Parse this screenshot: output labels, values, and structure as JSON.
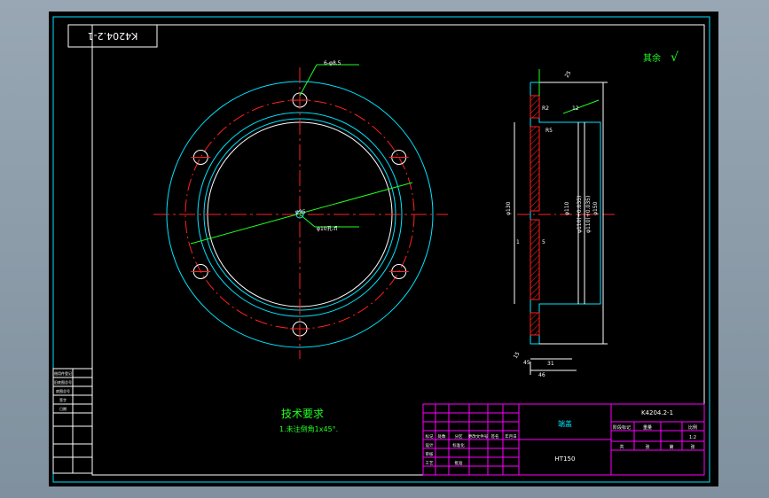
{
  "drawing": {
    "number_rotated": "K4204.2-1",
    "surface_note": "其余",
    "surface_note_symbol": "√",
    "tech_title": "技术要求",
    "tech_note": "1.未注倒角1x45°.",
    "annotations": {
      "hole_note": "6-φ8.5",
      "center_dia": "φ95",
      "center_note": "φ10孔-fl",
      "dim_top": "25",
      "dim_12": "12",
      "dim_r2": "R2",
      "dim_r5": "R5",
      "dim_5": "5",
      "dim_1": "1",
      "dim_15": "15",
      "dim_bottom1": "31",
      "dim_bottom2": "46",
      "dim_bottom3": "45",
      "dim_left": "φ130",
      "dim_mid": "φ110",
      "dim_vert1": "φ110(+0.035)",
      "dim_vert2": "φ110(+0.035)",
      "dim_right": "φ150"
    },
    "title_block": {
      "part_name": "端盖",
      "material": "HT150",
      "drawing_no": "K4204.2-1",
      "stage_label": "阶段标记",
      "weight_label": "重量",
      "scale_label": "比例",
      "scale_value": "1:2",
      "sheet_total": "共",
      "sheet_no": "第",
      "sheet_word": "张",
      "sheet_word2": "张",
      "rows": [
        [
          "标记",
          "处数",
          "分区",
          "更改文件号",
          "签名",
          "年月日"
        ],
        [
          "设计",
          "",
          "标准化",
          "",
          "",
          ""
        ],
        [
          "审核",
          "",
          "",
          "",
          "",
          ""
        ],
        [
          "工艺",
          "",
          "批准",
          "",
          "",
          ""
        ]
      ]
    },
    "left_strip": [
      "借用件登记",
      "旧底图总号",
      "底图总号",
      "签字",
      "日期"
    ]
  }
}
